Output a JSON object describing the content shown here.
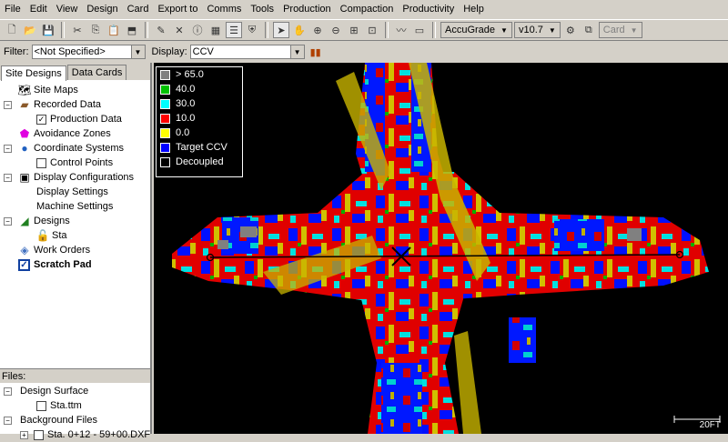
{
  "menu": [
    "File",
    "Edit",
    "View",
    "Design",
    "Card",
    "Export to",
    "Comms",
    "Tools",
    "Production",
    "Compaction",
    "Productivity",
    "Help"
  ],
  "toolbar": {
    "product_combo": "AccuGrade",
    "version_combo": "v10.7",
    "card_label": "Card"
  },
  "filter": {
    "filter_label": "Filter:",
    "filter_value": "<Not Specified>",
    "display_label": "Display:",
    "display_value": "CCV"
  },
  "tabs": [
    "Site Designs",
    "Data Cards"
  ],
  "tree": {
    "site_maps": "Site Maps",
    "recorded_data": "Recorded Data",
    "production_data": "Production Data",
    "avoidance_zones": "Avoidance Zones",
    "coordinate_systems": "Coordinate Systems",
    "control_points": "Control Points",
    "display_configurations": "Display Configurations",
    "display_settings": "Display Settings",
    "machine_settings": "Machine Settings",
    "designs": "Designs",
    "sta": "Sta",
    "work_orders": "Work Orders",
    "scratch_pad": "Scratch Pad"
  },
  "files": {
    "header": "Files:",
    "design_surface": "Design Surface",
    "sta_ttm": "Sta.ttm",
    "background_files": "Background Files",
    "dxf": "Sta. 0+12 - 59+00.DXF"
  },
  "legend": [
    {
      "label": "> 65.0",
      "color": "#808080"
    },
    {
      "label": "40.0",
      "color": "#00c000"
    },
    {
      "label": "30.0",
      "color": "#00ffff"
    },
    {
      "label": "10.0",
      "color": "#ff0000"
    },
    {
      "label": "0.0",
      "color": "#ffff00"
    },
    {
      "label": "Target CCV",
      "color": "#0000ff"
    },
    {
      "label": "Decoupled",
      "color": "#000000"
    }
  ],
  "scale_label": "20FT"
}
